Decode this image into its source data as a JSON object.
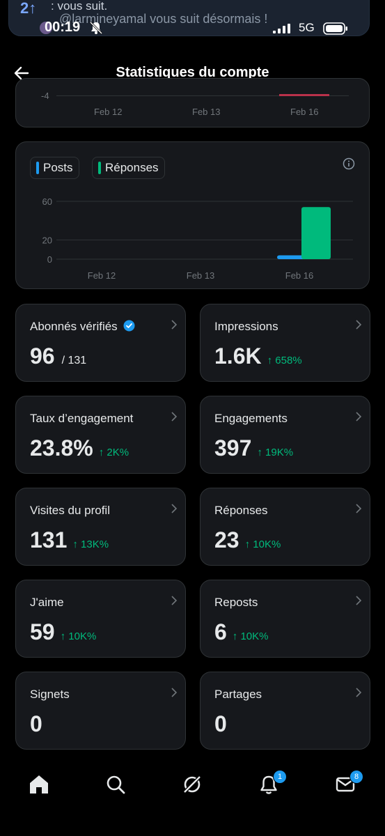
{
  "notification": {
    "line1": ": vous suit.",
    "line2": "@larmineyamal vous suit désormais !"
  },
  "status_bar": {
    "time": "00:19",
    "network": "5G"
  },
  "header": {
    "title": "Statistiques du compte"
  },
  "top_chart": {
    "y_tick": "-4",
    "x_ticks": [
      "Feb 12",
      "Feb 13",
      "Feb 16"
    ]
  },
  "chart_data": {
    "type": "bar",
    "categories": [
      "Feb 12",
      "Feb 13",
      "Feb 16"
    ],
    "series": [
      {
        "name": "Posts",
        "values": [
          0,
          0,
          4
        ],
        "color": "#1d9bf0"
      },
      {
        "name": "Réponses",
        "values": [
          0,
          0,
          54
        ],
        "color": "#00ba7c"
      }
    ],
    "y_ticks": [
      "60",
      "20",
      "0"
    ],
    "ylim": [
      0,
      60
    ]
  },
  "stats": [
    {
      "label": "Abonnés vérifiés",
      "value": "96",
      "sub": "/ 131",
      "delta": "",
      "verified": true
    },
    {
      "label": "Impressions",
      "value": "1.6K",
      "sub": "",
      "delta": "↑ 658%"
    },
    {
      "label": "Taux d’engagement",
      "value": "23.8%",
      "sub": "",
      "delta": "↑ 2K%"
    },
    {
      "label": "Engagements",
      "value": "397",
      "sub": "",
      "delta": "↑ 19K%"
    },
    {
      "label": "Visites du profil",
      "value": "131",
      "sub": "",
      "delta": "↑ 13K%"
    },
    {
      "label": "Réponses",
      "value": "23",
      "sub": "",
      "delta": "↑ 10K%"
    },
    {
      "label": "J'aime",
      "value": "59",
      "sub": "",
      "delta": "↑ 10K%"
    },
    {
      "label": "Reposts",
      "value": "6",
      "sub": "",
      "delta": "↑ 10K%"
    },
    {
      "label": "Signets",
      "value": "0",
      "sub": "",
      "delta": ""
    },
    {
      "label": "Partages",
      "value": "0",
      "sub": "",
      "delta": ""
    }
  ],
  "tabbar": {
    "notifications_badge": "1",
    "messages_badge": "8",
    "icons": [
      "home-icon",
      "search-icon",
      "grok-icon",
      "bell-icon",
      "mail-icon"
    ]
  },
  "colors": {
    "accent": "#1d9bf0",
    "positive": "#00ba7c",
    "card": "#16181c"
  }
}
